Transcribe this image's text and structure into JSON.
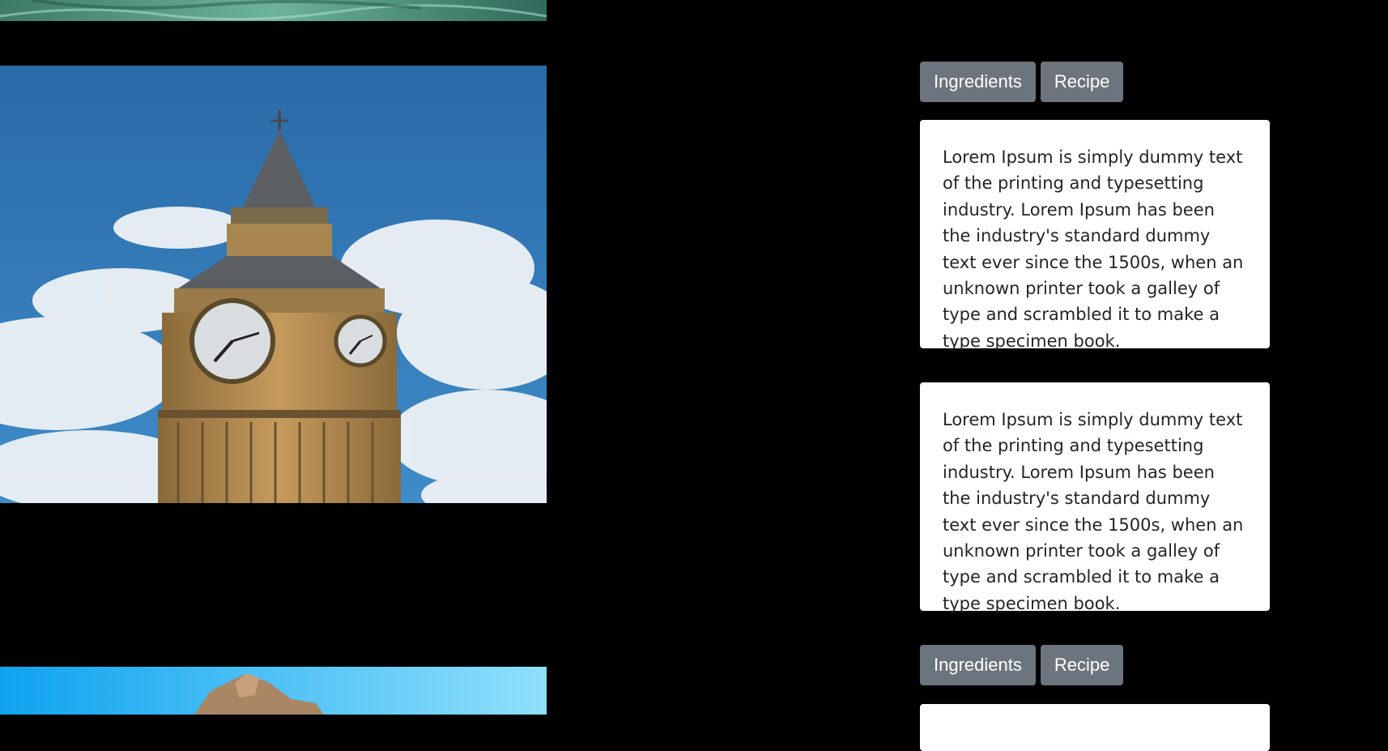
{
  "sections": [
    {
      "buttons": {
        "ingredients": "Ingredients",
        "recipe": "Recipe"
      },
      "cards": [
        "Lorem Ipsum is simply dummy text of the printing and typesetting industry. Lorem Ipsum has been the industry's standard dummy text ever since the 1500s, when an unknown printer took a galley of type and scrambled it to make a type specimen book.",
        "Lorem Ipsum is simply dummy text of the printing and typesetting industry. Lorem Ipsum has been the industry's standard dummy text ever since the 1500s, when an unknown printer took a galley of type and scrambled it to make a type specimen book."
      ]
    },
    {
      "buttons": {
        "ingredients": "Ingredients",
        "recipe": "Recipe"
      }
    }
  ],
  "colors": {
    "background": "#000000",
    "button": "#6c757d",
    "card": "#ffffff",
    "text": "#212529"
  }
}
